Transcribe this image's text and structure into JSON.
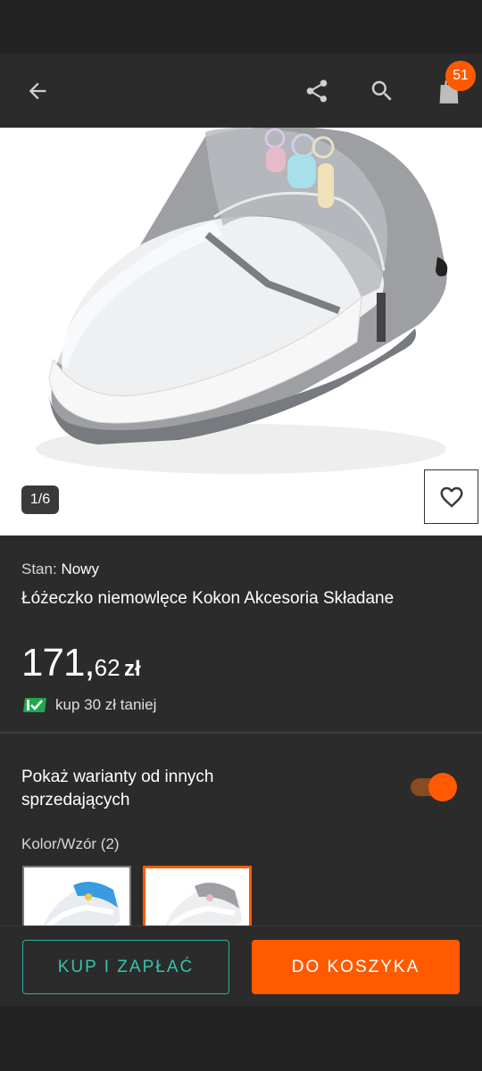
{
  "header": {
    "back_icon": "arrow-left-icon",
    "share_icon": "share-icon",
    "search_icon": "search-icon",
    "cart_icon": "shopping-bag-icon",
    "cart_count": "51"
  },
  "gallery": {
    "counter": "1/6",
    "wishlist_icon": "heart-icon"
  },
  "product": {
    "condition_label": "Stan:",
    "condition_value": "Nowy",
    "title": "Łóżeczko niemowlęce Kokon Akcesoria Składane",
    "price_int": "171,",
    "price_dec": "62",
    "price_currency": "zł",
    "smart_icon": "smart-ticket-icon",
    "smart_text": "kup 30 zł taniej"
  },
  "variants": {
    "toggle_label": "Pokaż warianty od innych sprzedających",
    "toggle_on": true,
    "color_label": "Kolor/Wzór (2)"
  },
  "actions": {
    "buy_label": "KUP I ZAPŁAĆ",
    "cart_label": "DO KOSZYKA"
  },
  "colors": {
    "accent": "#ff5a00",
    "teal": "#35c4ae",
    "background": "#2b2b2b"
  }
}
